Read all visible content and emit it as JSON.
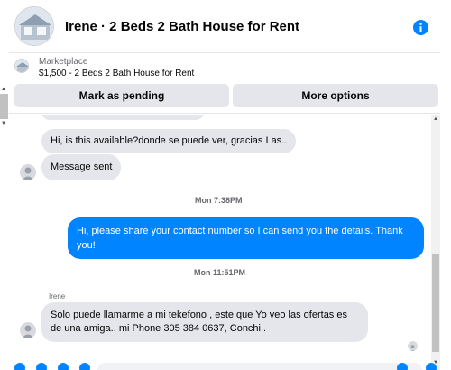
{
  "header": {
    "title": "Irene · 2 Beds 2 Bath House for Rent",
    "info_icon": "info-icon",
    "accent_color": "#0084ff"
  },
  "marketplace": {
    "label": "Marketplace",
    "listing": "$1,500 - 2 Beds 2 Bath House for Rent",
    "primary_button": "Mark as pending",
    "secondary_button": "More options"
  },
  "messages": [
    {
      "type": "incoming",
      "text": "Hi, is this available?donde se puede ver, gracias I as.."
    },
    {
      "type": "incoming",
      "text": "Message sent"
    },
    {
      "type": "timestamp",
      "text": "Mon 7:38PM"
    },
    {
      "type": "outgoing",
      "text": "Hi, please share your contact number so I can send you the details. Thank you!"
    },
    {
      "type": "timestamp",
      "text": "Mon 11:51PM"
    },
    {
      "type": "sender",
      "text": "Irene"
    },
    {
      "type": "incoming",
      "text": "Solo puede llamarme a mi tekefono , este que Yo veo las ofertas es de una amiga.. mi Phone 305 384 0637, Conchi.."
    }
  ]
}
